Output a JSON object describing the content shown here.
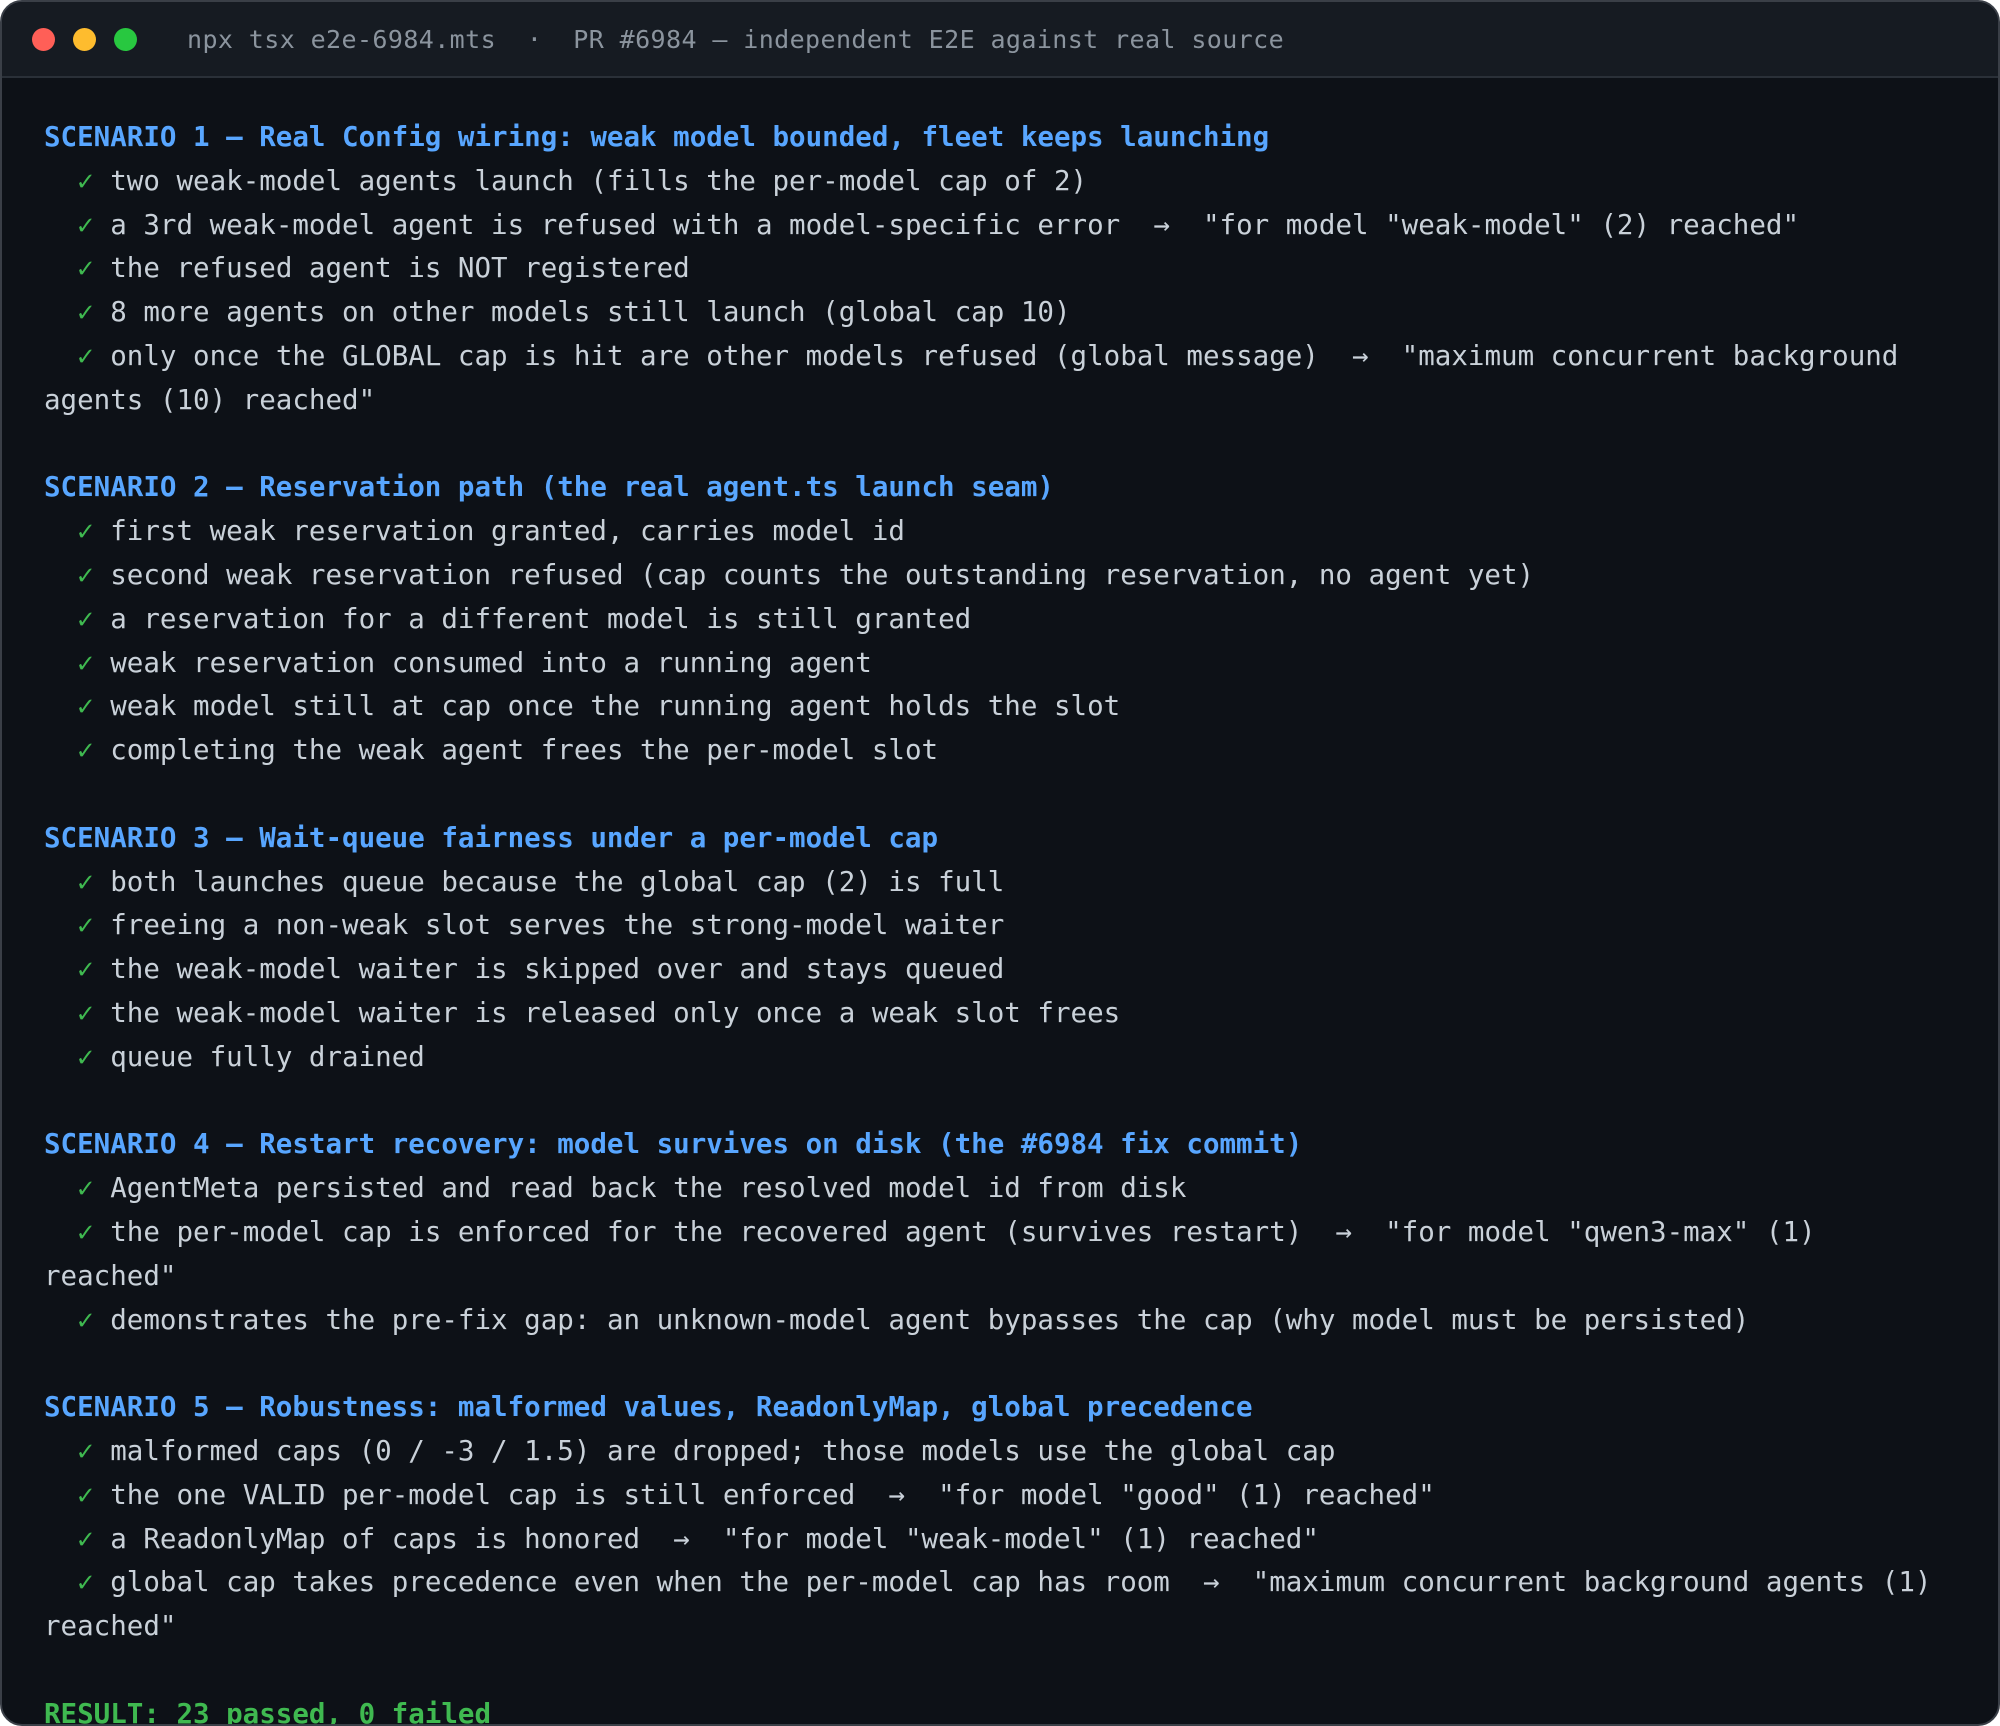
{
  "window": {
    "title": "npx tsx e2e-6984.mts  ·  PR #6984 — independent E2E against real source",
    "colors": {
      "close": "#ff5f57",
      "minimize": "#febc2e",
      "maximize": "#28c840",
      "heading": "#58a6ff",
      "pass": "#3fb950",
      "text": "#c9d1d9",
      "background": "#0d1117"
    }
  },
  "check_glyph": "✓",
  "sections": [
    {
      "title": "SCENARIO 1 — Real Config wiring: weak model bounded, fleet keeps launching",
      "lines": [
        {
          "text": "two weak-model agents launch (fills the per-model cap of 2)",
          "detail": ""
        },
        {
          "text": "a 3rd weak-model agent is refused with a model-specific error",
          "detail": "\"for model \"weak-model\" (2) reached\""
        },
        {
          "text": "the refused agent is NOT registered",
          "detail": ""
        },
        {
          "text": "8 more agents on other models still launch (global cap 10)",
          "detail": ""
        },
        {
          "text": "only once the GLOBAL cap is hit are other models refused (global message)",
          "detail": "\"maximum concurrent background agents (10) reached\""
        }
      ]
    },
    {
      "title": "SCENARIO 2 — Reservation path (the real agent.ts launch seam)",
      "lines": [
        {
          "text": "first weak reservation granted, carries model id",
          "detail": ""
        },
        {
          "text": "second weak reservation refused (cap counts the outstanding reservation, no agent yet)",
          "detail": ""
        },
        {
          "text": "a reservation for a different model is still granted",
          "detail": ""
        },
        {
          "text": "weak reservation consumed into a running agent",
          "detail": ""
        },
        {
          "text": "weak model still at cap once the running agent holds the slot",
          "detail": ""
        },
        {
          "text": "completing the weak agent frees the per-model slot",
          "detail": ""
        }
      ]
    },
    {
      "title": "SCENARIO 3 — Wait-queue fairness under a per-model cap",
      "lines": [
        {
          "text": "both launches queue because the global cap (2) is full",
          "detail": ""
        },
        {
          "text": "freeing a non-weak slot serves the strong-model waiter",
          "detail": ""
        },
        {
          "text": "the weak-model waiter is skipped over and stays queued",
          "detail": ""
        },
        {
          "text": "the weak-model waiter is released only once a weak slot frees",
          "detail": ""
        },
        {
          "text": "queue fully drained",
          "detail": ""
        }
      ]
    },
    {
      "title": "SCENARIO 4 — Restart recovery: model survives on disk (the #6984 fix commit)",
      "lines": [
        {
          "text": "AgentMeta persisted and read back the resolved model id from disk",
          "detail": ""
        },
        {
          "text": "the per-model cap is enforced for the recovered agent (survives restart)",
          "detail": "\"for model \"qwen3-max\" (1) reached\""
        },
        {
          "text": "demonstrates the pre-fix gap: an unknown-model agent bypasses the cap (why model must be persisted)",
          "detail": ""
        }
      ]
    },
    {
      "title": "SCENARIO 5 — Robustness: malformed values, ReadonlyMap, global precedence",
      "lines": [
        {
          "text": "malformed caps (0 / -3 / 1.5) are dropped; those models use the global cap",
          "detail": ""
        },
        {
          "text": "the one VALID per-model cap is still enforced",
          "detail": "\"for model \"good\" (1) reached\""
        },
        {
          "text": "a ReadonlyMap of caps is honored",
          "detail": "\"for model \"weak-model\" (1) reached\""
        },
        {
          "text": "global cap takes precedence even when the per-model cap has room",
          "detail": "\"maximum concurrent background agents (1) reached\""
        }
      ]
    }
  ],
  "result": "RESULT: 23 passed, 0 failed"
}
